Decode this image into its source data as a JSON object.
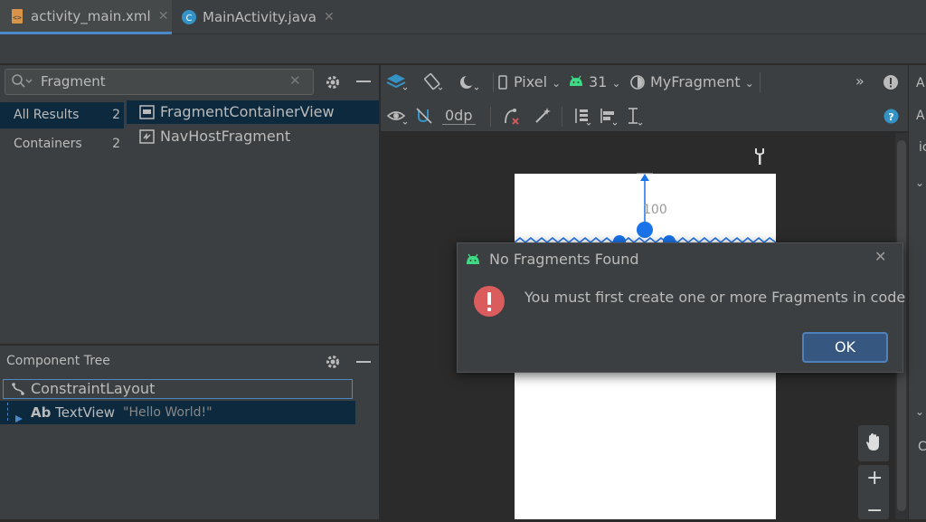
{
  "tabs": [
    {
      "label": "activity_main.xml",
      "close": "✕"
    },
    {
      "label": "MainActivity.java",
      "close": "✕"
    }
  ],
  "palette": {
    "search_value": "Fragment",
    "search_clear": "✕",
    "categories": [
      {
        "label": "All Results",
        "count": "2"
      },
      {
        "label": "Containers",
        "count": "2"
      }
    ],
    "items": [
      {
        "label": "FragmentContainerView"
      },
      {
        "label": "NavHostFragment"
      }
    ]
  },
  "component_tree": {
    "title": "Component Tree",
    "root": "ConstraintLayout",
    "child_prefix": "Ab",
    "child_label": "TextView",
    "child_value": "\"Hello World!\""
  },
  "toolbar": {
    "device": "Pixel",
    "api": "31",
    "theme": "MyFragment",
    "margin": "0dp",
    "overflow": "»"
  },
  "design": {
    "constraint_value": "100"
  },
  "right_strip": {
    "letters": [
      "A",
      "A",
      "ic",
      "C"
    ]
  },
  "dialog": {
    "title": "No Fragments Found",
    "close": "✕",
    "message": "You must first create one or more Fragments in code",
    "ok": "OK"
  },
  "zoom": {
    "plus": "+",
    "minus": "−"
  },
  "colors": {
    "accent": "#4a88c7",
    "android_green": "#3ddc84",
    "error_red": "#db5c5c",
    "selection": "#0d293e",
    "constraint_blue": "#1a73e8"
  }
}
